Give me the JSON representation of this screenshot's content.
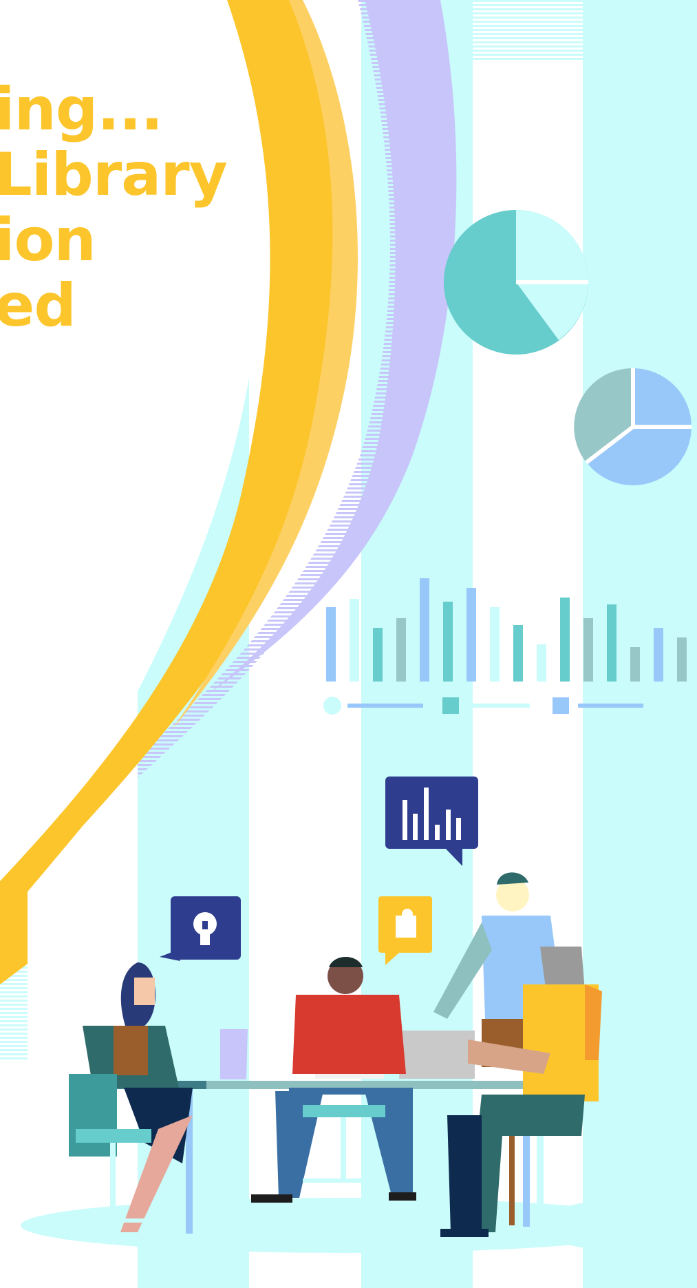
{
  "headline": {
    "lines": [
      "ing...",
      "Library",
      "ion",
      "ed"
    ]
  },
  "colors": {
    "accent_yellow": "#fcc52b",
    "light_cyan": "#c9fcfb",
    "teal": "#66cccc",
    "lavender": "#c7c5f9",
    "sky_blue": "#98c8f9",
    "navy": "#2f3d8f"
  },
  "icons": [
    "pie-chart-icon",
    "bar-chart-icon",
    "lightbulb-icon",
    "puzzle-icon"
  ]
}
